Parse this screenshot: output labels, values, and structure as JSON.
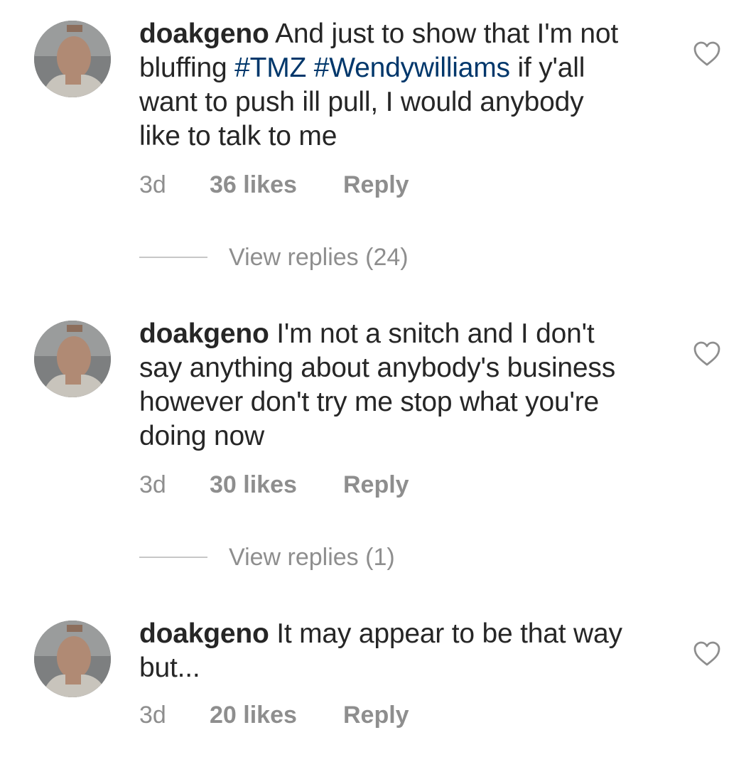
{
  "comments": [
    {
      "username": "doakgeno",
      "text_parts": [
        "And just to show that I'm not",
        "bluffing ",
        "#TMZ",
        " ",
        "#Wendywilliams",
        " if y'all",
        "want to push ill pull, I would anybody",
        "like to talk to me"
      ],
      "time": "3d",
      "likes": "36 likes",
      "reply": "Reply",
      "view_replies": "View replies (24)"
    },
    {
      "username": "doakgeno",
      "text_parts": [
        "I'm not a snitch and I don't",
        "say anything about anybody's business",
        "however don't try me stop what you're",
        "doing now"
      ],
      "time": "3d",
      "likes": "30 likes",
      "reply": "Reply",
      "view_replies": "View replies (1)"
    },
    {
      "username": "doakgeno",
      "text_parts": [
        "It may appear to be that way",
        "but..."
      ],
      "time": "3d",
      "likes": "20 likes",
      "reply": "Reply"
    }
  ],
  "icons": {
    "like": "heart-outline-icon",
    "avatar": "profile-photo"
  },
  "colors": {
    "text": "#262626",
    "secondary": "#8e8e8e",
    "hashtag": "#00376b",
    "divider": "#c7c7c7"
  }
}
